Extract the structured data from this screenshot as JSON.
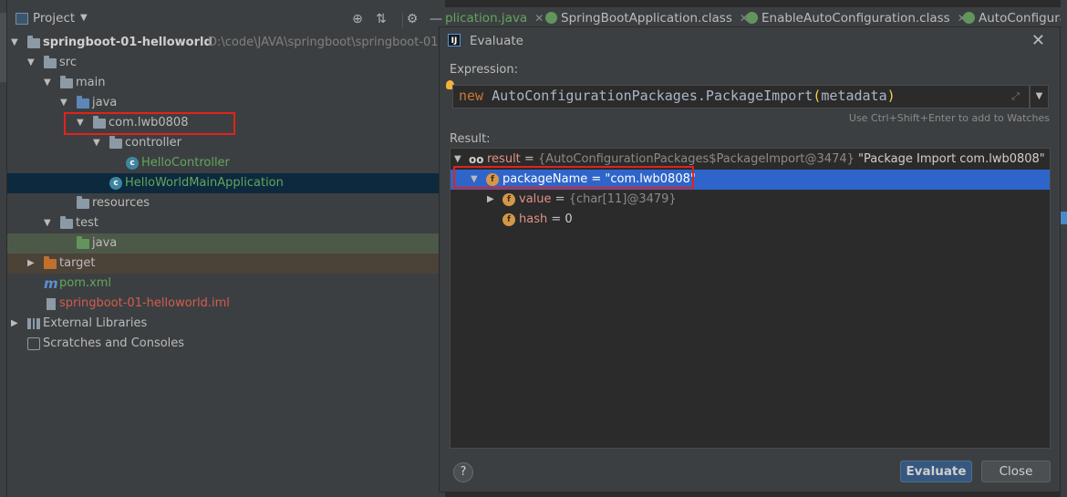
{
  "project_panel": {
    "title": "Project",
    "tree": [
      {
        "id": "root",
        "label": "springboot-01-helloworld",
        "path": "D:\\code\\JAVA\\springboot\\springboot-01"
      },
      {
        "id": "src",
        "label": "src"
      },
      {
        "id": "main",
        "label": "main"
      },
      {
        "id": "java",
        "label": "java"
      },
      {
        "id": "pkg",
        "label": "com.lwb0808"
      },
      {
        "id": "controller",
        "label": "controller"
      },
      {
        "id": "hello_controller",
        "label": "HelloController"
      },
      {
        "id": "main_app",
        "label": "HelloWorldMainApplication"
      },
      {
        "id": "resources",
        "label": "resources"
      },
      {
        "id": "test",
        "label": "test"
      },
      {
        "id": "test_java",
        "label": "java"
      },
      {
        "id": "target",
        "label": "target"
      },
      {
        "id": "pom",
        "label": "pom.xml"
      },
      {
        "id": "iml",
        "label": "springboot-01-helloworld.iml"
      },
      {
        "id": "ext_libs",
        "label": "External Libraries"
      },
      {
        "id": "scratches",
        "label": "Scratches and Consoles"
      }
    ]
  },
  "editor_tabs": [
    {
      "label": "plication.java"
    },
    {
      "label": "SpringBootApplication.class"
    },
    {
      "label": "EnableAutoConfiguration.class"
    },
    {
      "label": "AutoConfigurat"
    }
  ],
  "evaluate_dialog": {
    "title": "Evaluate",
    "expression_label": "Expression:",
    "expression": {
      "keyword": "new",
      "body": "AutoConfigurationPackages.PackageImport",
      "open_paren": "(",
      "arg": "metadata",
      "close_paren": ")"
    },
    "hint": "Use Ctrl+Shift+Enter to add to Watches",
    "result_label": "Result:",
    "result": {
      "root": {
        "name": "result",
        "eq": " = ",
        "type": "{AutoConfigurationPackages$PackageImport@3474}",
        "value": "\"Package Import com.lwb0808\""
      },
      "children": [
        {
          "name": "packageName",
          "eq": " = ",
          "value": "\"com.lwb0808\""
        },
        {
          "name": "value",
          "eq": " = ",
          "value": "{char[11]@3479}"
        },
        {
          "name": "hash",
          "eq": " = ",
          "value": "0"
        }
      ]
    },
    "buttons": {
      "evaluate": "Evaluate",
      "close": "Close",
      "help": "?"
    }
  },
  "colors": {
    "selection": "#2f65ca",
    "highlight_box": "#e0231c",
    "accent_green": "#62a65d",
    "error_red": "#d35c4d"
  }
}
